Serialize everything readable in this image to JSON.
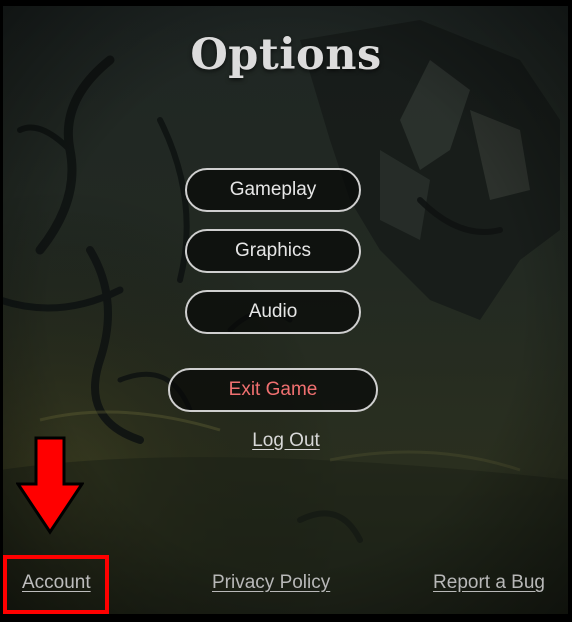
{
  "screen": {
    "title": "Options"
  },
  "menu": {
    "gameplay_label": "Gameplay",
    "graphics_label": "Graphics",
    "audio_label": "Audio",
    "exit_label": "Exit Game",
    "logout_label": "Log Out"
  },
  "footer": {
    "account_label": "Account",
    "privacy_label": "Privacy Policy",
    "report_label": "Report a Bug"
  },
  "colors": {
    "button_text": "#e6e6e6",
    "exit_text": "#f07070",
    "button_border": "#cfcfcf",
    "annotation_red": "#ff0000"
  },
  "icons": {
    "annotation_arrow": "down-arrow-icon"
  }
}
